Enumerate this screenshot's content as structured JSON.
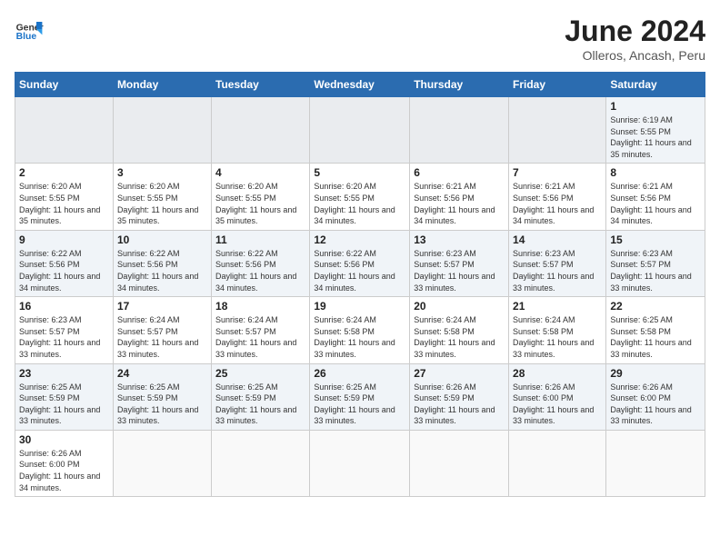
{
  "header": {
    "logo_general": "General",
    "logo_blue": "Blue",
    "month": "June 2024",
    "location": "Olleros, Ancash, Peru"
  },
  "weekdays": [
    "Sunday",
    "Monday",
    "Tuesday",
    "Wednesday",
    "Thursday",
    "Friday",
    "Saturday"
  ],
  "weeks": [
    [
      {
        "day": "",
        "info": ""
      },
      {
        "day": "",
        "info": ""
      },
      {
        "day": "",
        "info": ""
      },
      {
        "day": "",
        "info": ""
      },
      {
        "day": "",
        "info": ""
      },
      {
        "day": "",
        "info": ""
      },
      {
        "day": "1",
        "info": "Sunrise: 6:19 AM\nSunset: 5:55 PM\nDaylight: 11 hours and 35 minutes."
      }
    ],
    [
      {
        "day": "2",
        "info": "Sunrise: 6:20 AM\nSunset: 5:55 PM\nDaylight: 11 hours and 35 minutes."
      },
      {
        "day": "3",
        "info": "Sunrise: 6:20 AM\nSunset: 5:55 PM\nDaylight: 11 hours and 35 minutes."
      },
      {
        "day": "4",
        "info": "Sunrise: 6:20 AM\nSunset: 5:55 PM\nDaylight: 11 hours and 35 minutes."
      },
      {
        "day": "5",
        "info": "Sunrise: 6:20 AM\nSunset: 5:55 PM\nDaylight: 11 hours and 34 minutes."
      },
      {
        "day": "6",
        "info": "Sunrise: 6:21 AM\nSunset: 5:56 PM\nDaylight: 11 hours and 34 minutes."
      },
      {
        "day": "7",
        "info": "Sunrise: 6:21 AM\nSunset: 5:56 PM\nDaylight: 11 hours and 34 minutes."
      },
      {
        "day": "8",
        "info": "Sunrise: 6:21 AM\nSunset: 5:56 PM\nDaylight: 11 hours and 34 minutes."
      }
    ],
    [
      {
        "day": "9",
        "info": "Sunrise: 6:22 AM\nSunset: 5:56 PM\nDaylight: 11 hours and 34 minutes."
      },
      {
        "day": "10",
        "info": "Sunrise: 6:22 AM\nSunset: 5:56 PM\nDaylight: 11 hours and 34 minutes."
      },
      {
        "day": "11",
        "info": "Sunrise: 6:22 AM\nSunset: 5:56 PM\nDaylight: 11 hours and 34 minutes."
      },
      {
        "day": "12",
        "info": "Sunrise: 6:22 AM\nSunset: 5:56 PM\nDaylight: 11 hours and 34 minutes."
      },
      {
        "day": "13",
        "info": "Sunrise: 6:23 AM\nSunset: 5:57 PM\nDaylight: 11 hours and 33 minutes."
      },
      {
        "day": "14",
        "info": "Sunrise: 6:23 AM\nSunset: 5:57 PM\nDaylight: 11 hours and 33 minutes."
      },
      {
        "day": "15",
        "info": "Sunrise: 6:23 AM\nSunset: 5:57 PM\nDaylight: 11 hours and 33 minutes."
      }
    ],
    [
      {
        "day": "16",
        "info": "Sunrise: 6:23 AM\nSunset: 5:57 PM\nDaylight: 11 hours and 33 minutes."
      },
      {
        "day": "17",
        "info": "Sunrise: 6:24 AM\nSunset: 5:57 PM\nDaylight: 11 hours and 33 minutes."
      },
      {
        "day": "18",
        "info": "Sunrise: 6:24 AM\nSunset: 5:57 PM\nDaylight: 11 hours and 33 minutes."
      },
      {
        "day": "19",
        "info": "Sunrise: 6:24 AM\nSunset: 5:58 PM\nDaylight: 11 hours and 33 minutes."
      },
      {
        "day": "20",
        "info": "Sunrise: 6:24 AM\nSunset: 5:58 PM\nDaylight: 11 hours and 33 minutes."
      },
      {
        "day": "21",
        "info": "Sunrise: 6:24 AM\nSunset: 5:58 PM\nDaylight: 11 hours and 33 minutes."
      },
      {
        "day": "22",
        "info": "Sunrise: 6:25 AM\nSunset: 5:58 PM\nDaylight: 11 hours and 33 minutes."
      }
    ],
    [
      {
        "day": "23",
        "info": "Sunrise: 6:25 AM\nSunset: 5:59 PM\nDaylight: 11 hours and 33 minutes."
      },
      {
        "day": "24",
        "info": "Sunrise: 6:25 AM\nSunset: 5:59 PM\nDaylight: 11 hours and 33 minutes."
      },
      {
        "day": "25",
        "info": "Sunrise: 6:25 AM\nSunset: 5:59 PM\nDaylight: 11 hours and 33 minutes."
      },
      {
        "day": "26",
        "info": "Sunrise: 6:25 AM\nSunset: 5:59 PM\nDaylight: 11 hours and 33 minutes."
      },
      {
        "day": "27",
        "info": "Sunrise: 6:26 AM\nSunset: 5:59 PM\nDaylight: 11 hours and 33 minutes."
      },
      {
        "day": "28",
        "info": "Sunrise: 6:26 AM\nSunset: 6:00 PM\nDaylight: 11 hours and 33 minutes."
      },
      {
        "day": "29",
        "info": "Sunrise: 6:26 AM\nSunset: 6:00 PM\nDaylight: 11 hours and 33 minutes."
      }
    ],
    [
      {
        "day": "30",
        "info": "Sunrise: 6:26 AM\nSunset: 6:00 PM\nDaylight: 11 hours and 34 minutes."
      },
      {
        "day": "",
        "info": ""
      },
      {
        "day": "",
        "info": ""
      },
      {
        "day": "",
        "info": ""
      },
      {
        "day": "",
        "info": ""
      },
      {
        "day": "",
        "info": ""
      },
      {
        "day": "",
        "info": ""
      }
    ]
  ]
}
